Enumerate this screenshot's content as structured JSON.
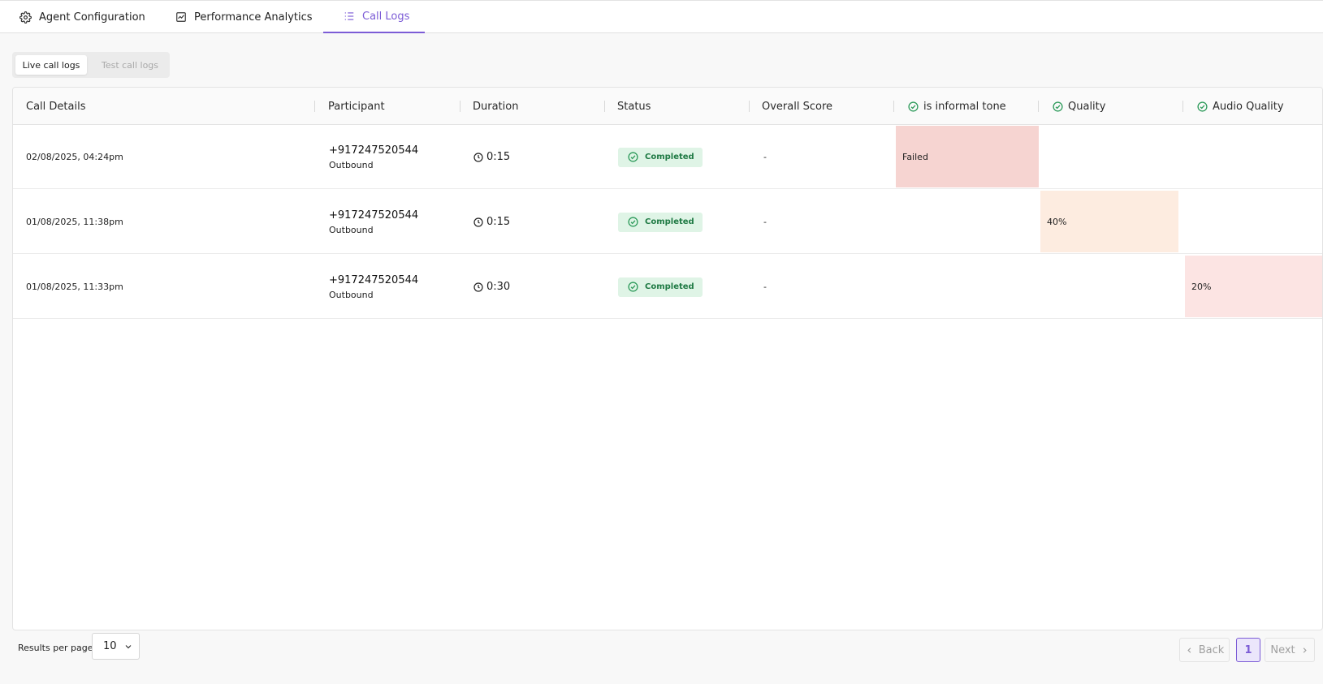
{
  "tabs": [
    {
      "label": "Agent Configuration",
      "icon": "gear-icon"
    },
    {
      "label": "Performance Analytics",
      "icon": "chart-icon"
    },
    {
      "label": "Call Logs",
      "icon": "list-icon",
      "active": true
    }
  ],
  "subtabs": {
    "live": "Live call logs",
    "test": "Test call logs"
  },
  "table": {
    "headers": {
      "call_details": "Call Details",
      "participant": "Participant",
      "duration": "Duration",
      "status": "Status",
      "overall_score": "Overall Score",
      "informal_tone": "is informal tone",
      "quality": "Quality",
      "audio_quality": "Audio Quality"
    },
    "rows": [
      {
        "date": "02/08/2025, 04:24pm",
        "phone": "+917247520544",
        "direction": "Outbound",
        "duration": "0:15",
        "status": "Completed",
        "overall_score": "-",
        "informal_tone": "Failed",
        "quality": "",
        "audio_quality": ""
      },
      {
        "date": "01/08/2025, 11:38pm",
        "phone": "+917247520544",
        "direction": "Outbound",
        "duration": "0:15",
        "status": "Completed",
        "overall_score": "-",
        "informal_tone": "",
        "quality": "40%",
        "audio_quality": ""
      },
      {
        "date": "01/08/2025, 11:33pm",
        "phone": "+917247520544",
        "direction": "Outbound",
        "duration": "0:30",
        "status": "Completed",
        "overall_score": "-",
        "informal_tone": "",
        "quality": "",
        "audio_quality": "20%"
      }
    ]
  },
  "footer": {
    "results_label": "Results per page",
    "per_page": "10",
    "back": "Back",
    "page": "1",
    "next": "Next"
  },
  "colors": {
    "accent": "#7c5cd6",
    "failed_bg": "#f6d4d1",
    "quality_bg": "#fdece0",
    "audio_bg": "#fce4e3",
    "completed_bg": "#dff4e6",
    "completed_text": "#1f7a44"
  }
}
